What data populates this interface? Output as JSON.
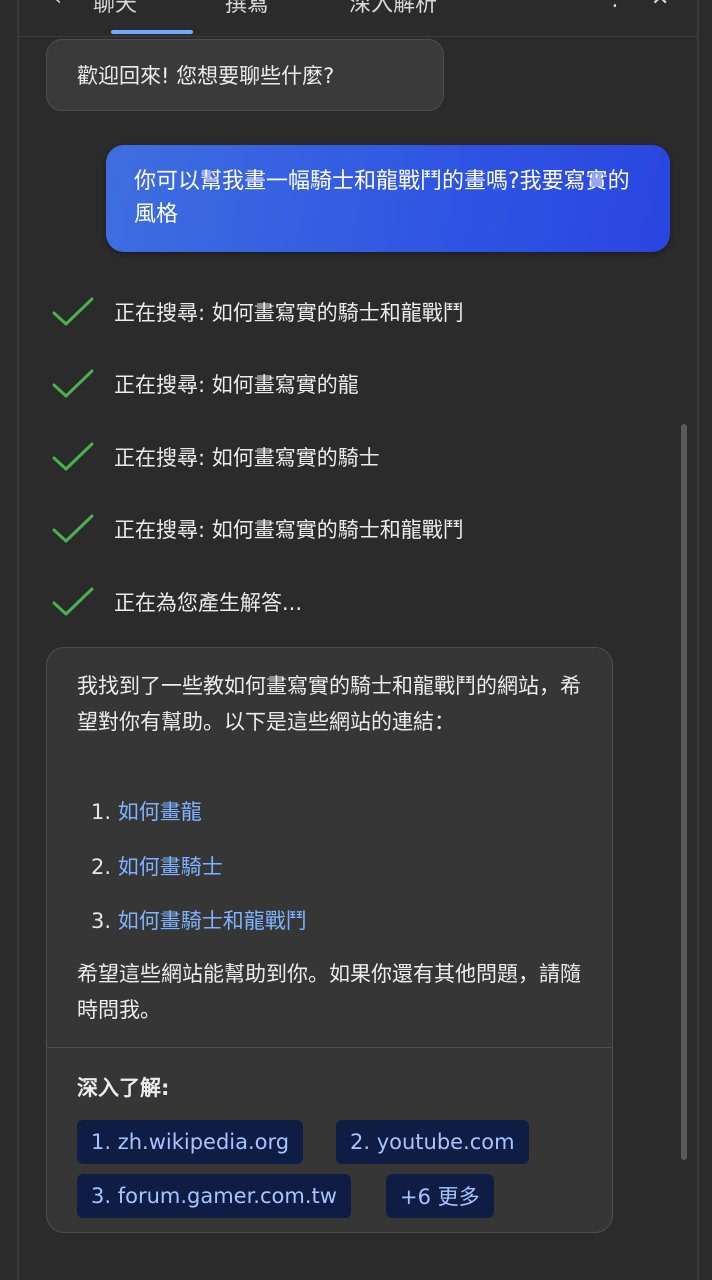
{
  "header": {
    "back": "‹",
    "chat_tab": "聊天",
    "compose_tab": "撰寫",
    "insights_tab": "深入解析",
    "more": "⋮",
    "close": "✕"
  },
  "messages": {
    "welcome": "歡迎回來! 您想要聊些什麼?",
    "user_prompt": "你可以幫我畫一幅騎士和龍戰鬥的畫嗎?我要寫實的風格"
  },
  "steps": [
    {
      "text": "正在搜尋: 如何畫寫實的騎士和龍戰鬥"
    },
    {
      "text": "正在搜尋: 如何畫寫實的龍"
    },
    {
      "text": "正在搜尋: 如何畫寫實的騎士"
    },
    {
      "text": "正在搜尋: 如何畫寫實的騎士和龍戰鬥"
    },
    {
      "text": "正在為您產生解答..."
    }
  ],
  "answer": {
    "intro": "我找到了一些教如何畫寫實的騎士和龍戰鬥的網站，希望對你有幫助。以下是這些網站的連結：",
    "links": [
      {
        "num": "1.",
        "label": "如何畫龍"
      },
      {
        "num": "2.",
        "label": "如何畫騎士"
      },
      {
        "num": "3.",
        "label": "如何畫騎士和龍戰鬥"
      }
    ],
    "outro": "希望這些網站能幫助到你。如果你還有其他問題，請隨時問我。",
    "learn_more": "深入了解:",
    "sources": [
      {
        "label": "1. zh.wikipedia.org"
      },
      {
        "label": "2. youtube.com"
      },
      {
        "label": "3. forum.gamer.com.tw"
      },
      {
        "label": "+6 更多"
      }
    ]
  },
  "colors": {
    "background": "#2b2b2b",
    "user_bubble": "#3060e0",
    "check": "#4caf50",
    "link": "#7fb2ff",
    "chip_bg": "#0f1c44"
  }
}
